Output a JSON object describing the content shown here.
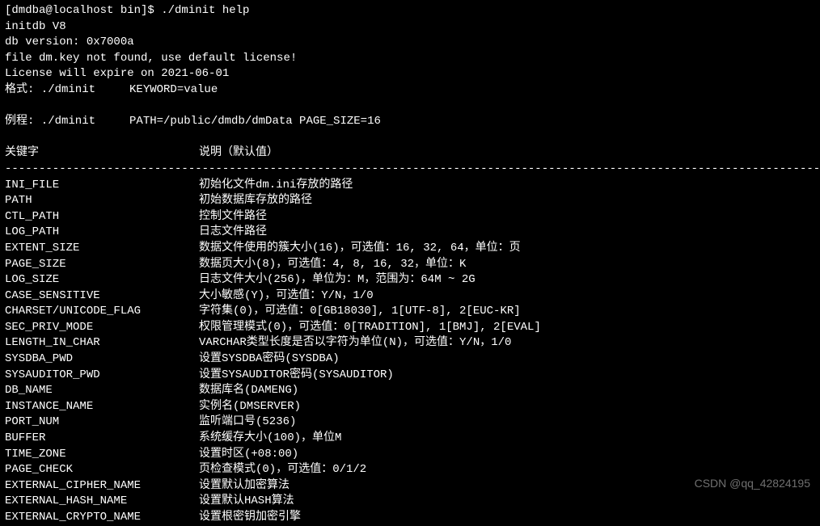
{
  "header": {
    "prompt": "[dmdba@localhost bin]$ ./dminit help",
    "initdb": "initdb V8",
    "dbversion": "db version: 0x7000a",
    "notfound": "file dm.key not found, use default license!",
    "license": "License will expire on 2021-06-01",
    "format": "格式: ./dminit     KEYWORD=value",
    "example": "例程: ./dminit     PATH=/public/dmdb/dmData PAGE_SIZE=16"
  },
  "table": {
    "header_key": "关键字",
    "header_desc": "说明（默认值）",
    "divider": "---------------------------------------------------------------------------------------------------------------------------",
    "rows": [
      {
        "key": "INI_FILE",
        "desc": "初始化文件dm.ini存放的路径"
      },
      {
        "key": "PATH",
        "desc": "初始数据库存放的路径"
      },
      {
        "key": "CTL_PATH",
        "desc": "控制文件路径"
      },
      {
        "key": "LOG_PATH",
        "desc": "日志文件路径"
      },
      {
        "key": "EXTENT_SIZE",
        "desc": "数据文件使用的簇大小(16)，可选值：16, 32, 64，单位：页"
      },
      {
        "key": "PAGE_SIZE",
        "desc": "数据页大小(8)，可选值：4, 8, 16, 32，单位：K"
      },
      {
        "key": "LOG_SIZE",
        "desc": "日志文件大小(256)，单位为：M，范围为：64M ~ 2G"
      },
      {
        "key": "CASE_SENSITIVE",
        "desc": "大小敏感(Y)，可选值：Y/N，1/0"
      },
      {
        "key": "CHARSET/UNICODE_FLAG",
        "desc": "字符集(0)，可选值：0[GB18030], 1[UTF-8], 2[EUC-KR]"
      },
      {
        "key": "SEC_PRIV_MODE",
        "desc": "权限管理模式(0)，可选值：0[TRADITION], 1[BMJ], 2[EVAL]"
      },
      {
        "key": "LENGTH_IN_CHAR",
        "desc": "VARCHAR类型长度是否以字符为单位(N)，可选值：Y/N，1/0"
      },
      {
        "key": "SYSDBA_PWD",
        "desc": "设置SYSDBA密码(SYSDBA)"
      },
      {
        "key": "SYSAUDITOR_PWD",
        "desc": "设置SYSAUDITOR密码(SYSAUDITOR)"
      },
      {
        "key": "DB_NAME",
        "desc": "数据库名(DAMENG)"
      },
      {
        "key": "INSTANCE_NAME",
        "desc": "实例名(DMSERVER)"
      },
      {
        "key": "PORT_NUM",
        "desc": "监听端口号(5236)"
      },
      {
        "key": "BUFFER",
        "desc": "系统缓存大小(100)，单位M"
      },
      {
        "key": "TIME_ZONE",
        "desc": "设置时区(+08:00)"
      },
      {
        "key": "PAGE_CHECK",
        "desc": "页检查模式(0)，可选值：0/1/2"
      },
      {
        "key": "EXTERNAL_CIPHER_NAME",
        "desc": "设置默认加密算法"
      },
      {
        "key": "EXTERNAL_HASH_NAME",
        "desc": "设置默认HASH算法"
      },
      {
        "key": "EXTERNAL_CRYPTO_NAME",
        "desc": "设置根密钥加密引擎"
      }
    ]
  },
  "watermark": "CSDN @qq_42824195"
}
